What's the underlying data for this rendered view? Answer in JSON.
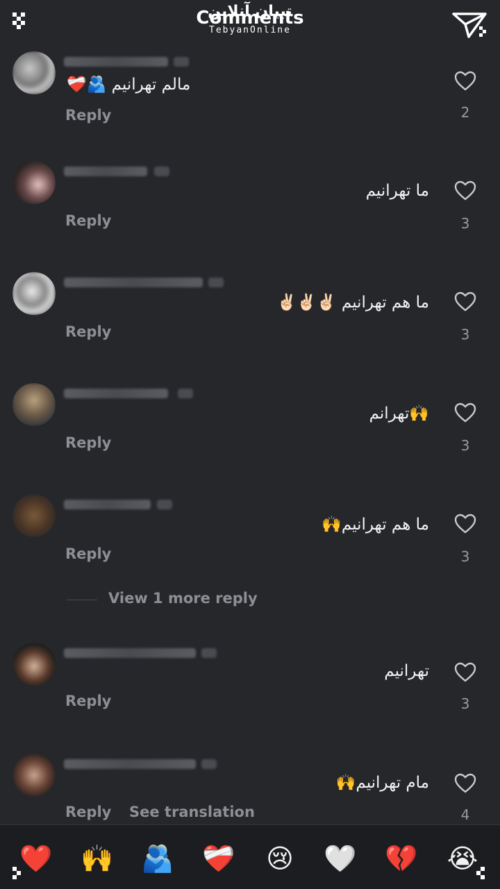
{
  "header": {
    "title_fa": "تبیان آنلاین",
    "title": "Comments",
    "brand": "TebyanOnline"
  },
  "comments": [
    {
      "text": "مالم تهرانیم 🫂❤️‍🩹",
      "likes": "2",
      "reply": "Reply"
    },
    {
      "text": "ما تهرانیم",
      "likes": "3",
      "reply": "Reply"
    },
    {
      "text": "ما هم تهرانیم ✌🏻✌🏻✌🏻",
      "likes": "3",
      "reply": "Reply"
    },
    {
      "text": "🙌تهرانم",
      "likes": "3",
      "reply": "Reply"
    },
    {
      "text": "ما هم تهرانیم🙌",
      "likes": "3",
      "reply": "Reply"
    },
    {
      "text": "تهرانیم",
      "likes": "3",
      "reply": "Reply"
    },
    {
      "text": "مام تهرانیم🙌",
      "likes": "4",
      "reply": "Reply",
      "see_translation": "See translation"
    }
  ],
  "view_more": "View 1 more reply",
  "reactions": [
    "❤️",
    "🙌",
    "🫂",
    "❤️‍🩹",
    "😢",
    "🤍",
    "💔",
    "😭"
  ],
  "colors": {
    "background": "#26272b",
    "secondary_text": "#8e8f94",
    "reaction_bar": "#1c1d20"
  }
}
